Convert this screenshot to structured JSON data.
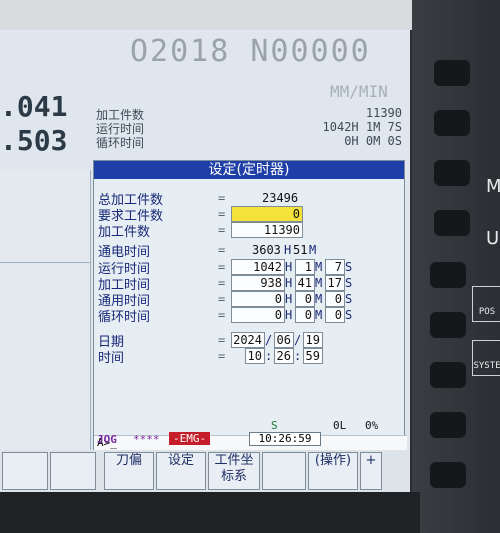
{
  "background": {
    "program_header": "O2018 N00000",
    "feed_unit": "MM/MIN",
    "coord_top": ".041",
    "coord_bottom": ".503",
    "rows": [
      {
        "label": "加工件数",
        "value": "11390"
      },
      {
        "label": "运行时间",
        "value": "1042H 1M 7S"
      },
      {
        "label": "循环时间",
        "value": "0H 0M 0S"
      }
    ]
  },
  "dialog": {
    "title": "设定(定时器)",
    "total_parts_label": "总加工件数",
    "total_parts_value": "23496",
    "required_parts_label": "要求工件数",
    "required_parts_value": "0",
    "parts_count_label": "加工件数",
    "parts_count_value": "11390",
    "power_on_label": "通电时间",
    "power_on_h": "3603",
    "power_on_m": "51",
    "run_label": "运行时间",
    "run_h": "1042",
    "run_m": "1",
    "run_s": "7",
    "cutting_label": "加工时间",
    "cutting_h": "938",
    "cutting_m": "41",
    "cutting_s": "17",
    "free_label": "通用时间",
    "free_h": "0",
    "free_m": "0",
    "free_s": "0",
    "cycle_label": "循环时间",
    "cycle_h": "0",
    "cycle_m": "0",
    "cycle_s": "0",
    "date_label": "日期",
    "date_y": "2024",
    "date_mo": "06",
    "date_d": "19",
    "time_label": "时间",
    "time_h": "10",
    "time_m": "26",
    "time_s": "59",
    "eq": "=",
    "unit_h": "H",
    "unit_m": "M",
    "unit_s": "S",
    "sep_date": "/",
    "sep_time": ":",
    "prompt": "A>_"
  },
  "status": {
    "spindle": "S",
    "load": "0L",
    "percent": "0%",
    "mode": "JOG",
    "stars": "****",
    "alarm": "-EMG-",
    "clock": "10:26:59"
  },
  "softkeys": [
    "",
    "",
    "刀偏",
    "设定",
    "工件坐标系",
    "",
    "(操作)",
    "+"
  ],
  "panel": {
    "key_m": "M",
    "key_u": "U",
    "pos_label": "POS",
    "system_label": "SYSTE"
  },
  "colors": {
    "title_bar": "#1f3fa8",
    "highlight_field": "#f3e23a",
    "emergency": "#c61d2a",
    "mode_text": "#7a2aa0"
  }
}
